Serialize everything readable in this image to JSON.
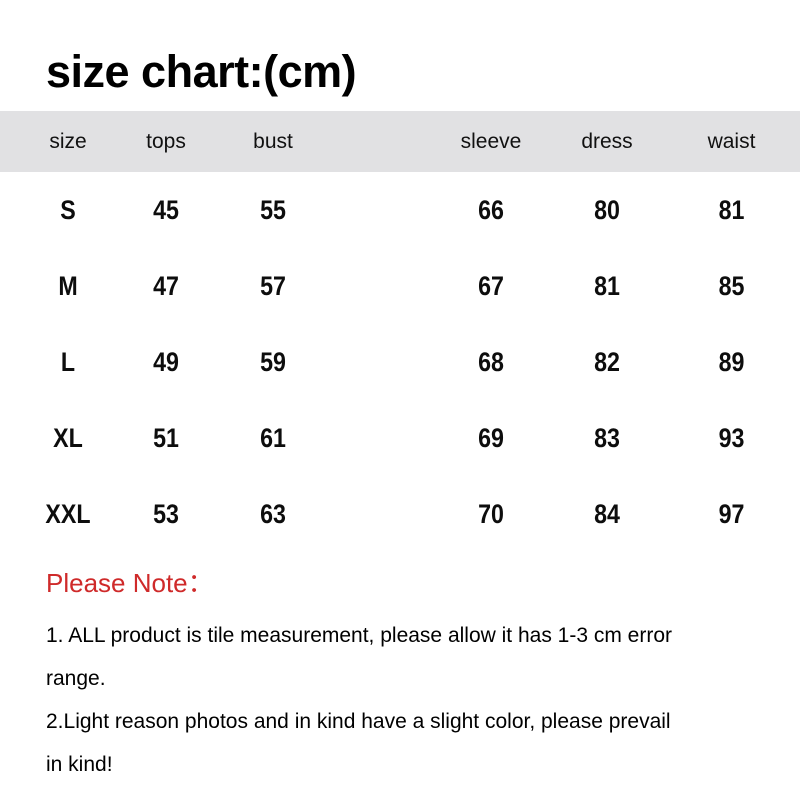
{
  "title": "size chart:(cm)",
  "table": {
    "headers": [
      "size",
      "tops",
      "bust",
      "sleeve",
      "dress",
      "waist"
    ],
    "rows": [
      {
        "size": "S",
        "tops": "45",
        "bust": "55",
        "sleeve": "66",
        "dress": "80",
        "waist": "81"
      },
      {
        "size": "M",
        "tops": "47",
        "bust": "57",
        "sleeve": "67",
        "dress": "81",
        "waist": "85"
      },
      {
        "size": "L",
        "tops": "49",
        "bust": "59",
        "sleeve": "68",
        "dress": "82",
        "waist": "89"
      },
      {
        "size": "XL",
        "tops": "51",
        "bust": "61",
        "sleeve": "69",
        "dress": "83",
        "waist": "93"
      },
      {
        "size": "XXL",
        "tops": "53",
        "bust": "63",
        "sleeve": "70",
        "dress": "84",
        "waist": "97"
      }
    ],
    "header_background": "#e1e1e3"
  },
  "notes": {
    "heading": "Please Note：",
    "heading_color": "#cf2a2a",
    "lines": [
      "1. ALL product is tile measurement, please allow it has 1-3 cm error",
      "range.",
      "2.Light reason photos and in kind have a slight color, please prevail",
      "in kind!"
    ]
  },
  "chart_data": {
    "type": "table",
    "title": "size chart:(cm)",
    "unit": "cm",
    "columns": [
      "size",
      "tops",
      "bust",
      "sleeve",
      "dress",
      "waist"
    ],
    "categories": [
      "S",
      "M",
      "L",
      "XL",
      "XXL"
    ],
    "series": [
      {
        "name": "tops",
        "values": [
          45,
          47,
          49,
          51,
          53
        ]
      },
      {
        "name": "bust",
        "values": [
          55,
          57,
          59,
          61,
          63
        ]
      },
      {
        "name": "sleeve",
        "values": [
          66,
          67,
          68,
          69,
          70
        ]
      },
      {
        "name": "dress",
        "values": [
          80,
          81,
          82,
          83,
          84
        ]
      },
      {
        "name": "waist",
        "values": [
          81,
          85,
          89,
          93,
          97
        ]
      }
    ],
    "rows": [
      [
        "S",
        45,
        55,
        66,
        80,
        81
      ],
      [
        "M",
        47,
        57,
        67,
        81,
        85
      ],
      [
        "L",
        49,
        59,
        68,
        82,
        89
      ],
      [
        "XL",
        51,
        61,
        69,
        83,
        93
      ],
      [
        "XXL",
        53,
        63,
        70,
        84,
        97
      ]
    ],
    "xlabel": "",
    "ylabel": "",
    "grid": false,
    "legend": "none"
  }
}
